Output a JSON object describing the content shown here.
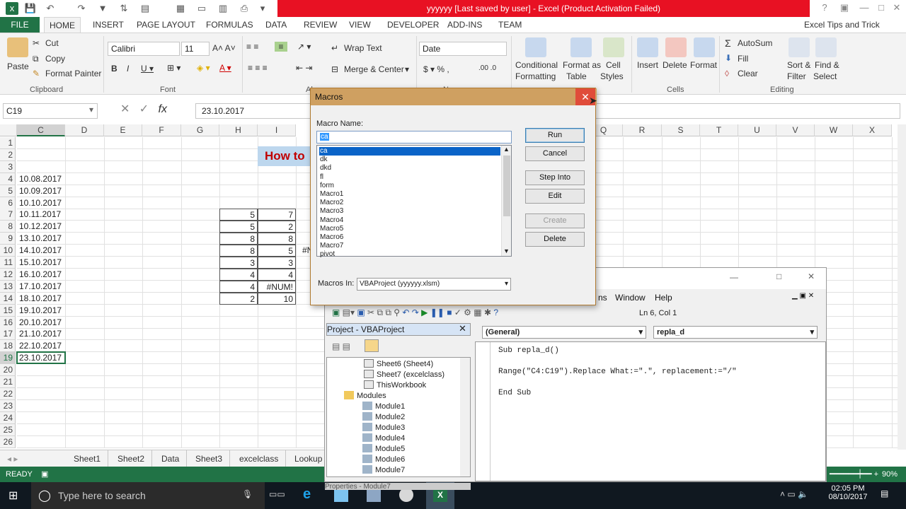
{
  "title_bar": {
    "text": "yyyyyy [Last saved by user]  -  Excel (Product Activation Failed)"
  },
  "ribbon_tabs": [
    "FILE",
    "HOME",
    "INSERT",
    "PAGE LAYOUT",
    "FORMULAS",
    "DATA",
    "REVIEW",
    "VIEW",
    "DEVELOPER",
    "ADD-INS",
    "TEAM"
  ],
  "account": "Excel Tips and Trick",
  "clipboard": {
    "paste": "Paste",
    "cut": "Cut",
    "copy": "Copy",
    "format_painter": "Format Painter",
    "group": "Clipboard"
  },
  "font": {
    "name": "Calibri",
    "size": "11",
    "group": "Font"
  },
  "alignment": {
    "wrap": "Wrap Text",
    "merge": "Merge & Center",
    "group": "Al"
  },
  "number": {
    "format": "Date",
    "group": "N"
  },
  "styles": {
    "cond1": "Conditional",
    "cond2": "Formatting",
    "fmt1": "Format as",
    "fmt2": "Table",
    "cell1": "Cell",
    "cell2": "Styles"
  },
  "cells": {
    "insert": "Insert",
    "delete": "Delete",
    "format": "Format",
    "group": "Cells"
  },
  "editing": {
    "autosum": "AutoSum",
    "fill": "Fill",
    "clear": "Clear",
    "sort1": "Sort &",
    "sort2": "Filter",
    "find1": "Find &",
    "find2": "Select",
    "group": "Editing"
  },
  "formula_bar": {
    "name_box": "C19",
    "fx": "fx",
    "value": "23.10.2017"
  },
  "columns": [
    "C",
    "D",
    "E",
    "F",
    "G",
    "H",
    "I",
    "Q",
    "R",
    "S",
    "T",
    "U",
    "V",
    "W",
    "X"
  ],
  "rows": [
    "1",
    "2",
    "3",
    "4",
    "5",
    "6",
    "7",
    "8",
    "9",
    "10",
    "11",
    "12",
    "13",
    "14",
    "15",
    "16",
    "17",
    "18",
    "19",
    "20",
    "21",
    "22",
    "23",
    "24",
    "25",
    "26"
  ],
  "dates": [
    "10.08.2017",
    "10.09.2017",
    "10.10.2017",
    "10.11.2017",
    "10.12.2017",
    "13.10.2017",
    "14.10.2017",
    "15.10.2017",
    "16.10.2017",
    "17.10.2017",
    "18.10.2017",
    "19.10.2017",
    "20.10.2017",
    "21.10.2017",
    "22.10.2017",
    "23.10.2017"
  ],
  "h_values": [
    "5",
    "5",
    "8",
    "8",
    "3",
    "4",
    "4",
    "2"
  ],
  "i_values": [
    "7",
    "2",
    "8",
    "5",
    "3",
    "4",
    "#NUM!",
    "10"
  ],
  "partial_j": "#N",
  "heading": "How to",
  "sheet_tabs": [
    "Sheet1",
    "Sheet2",
    "Data",
    "Sheet3",
    "excelclass",
    "Lookup"
  ],
  "status": {
    "ready": "READY",
    "zoom": "90%"
  },
  "taskbar": {
    "search": "Type here to search",
    "time": "02:05 PM",
    "date": "08/10/2017"
  },
  "macros": {
    "title": "Macros",
    "name_label": "Macro Name:",
    "name_value": "ca",
    "list": [
      "ca",
      "dk",
      "dkd",
      "fl",
      "form",
      "Macro1",
      "Macro2",
      "Macro3",
      "Macro4",
      "Macro5",
      "Macro6",
      "Macro7",
      "pivot"
    ],
    "buttons": {
      "run": "Run",
      "cancel": "Cancel",
      "step": "Step Into",
      "edit": "Edit",
      "create": "Create",
      "delete": "Delete"
    },
    "in_label": "Macros In:",
    "in_value": "VBAProject (yyyyyy.xlsm)"
  },
  "vba": {
    "menu": {
      "window": "Window",
      "help": "Help",
      "partial": "ns"
    },
    "position": "Ln 6, Col 1",
    "project_title": "Project - VBAProject",
    "tree": [
      "Sheet6 (Sheet4)",
      "Sheet7 (excelclass)",
      "ThisWorkbook",
      "Modules",
      "Module1",
      "Module2",
      "Module3",
      "Module4",
      "Module5",
      "Module6",
      "Module7"
    ],
    "general": "(General)",
    "proc": "repla_d",
    "code": [
      "Sub repla_d()",
      "Range(\"C4:C19\").Replace What:=\".\", replacement:=\"/\"",
      "End Sub"
    ],
    "props": "Properties - Module7"
  }
}
